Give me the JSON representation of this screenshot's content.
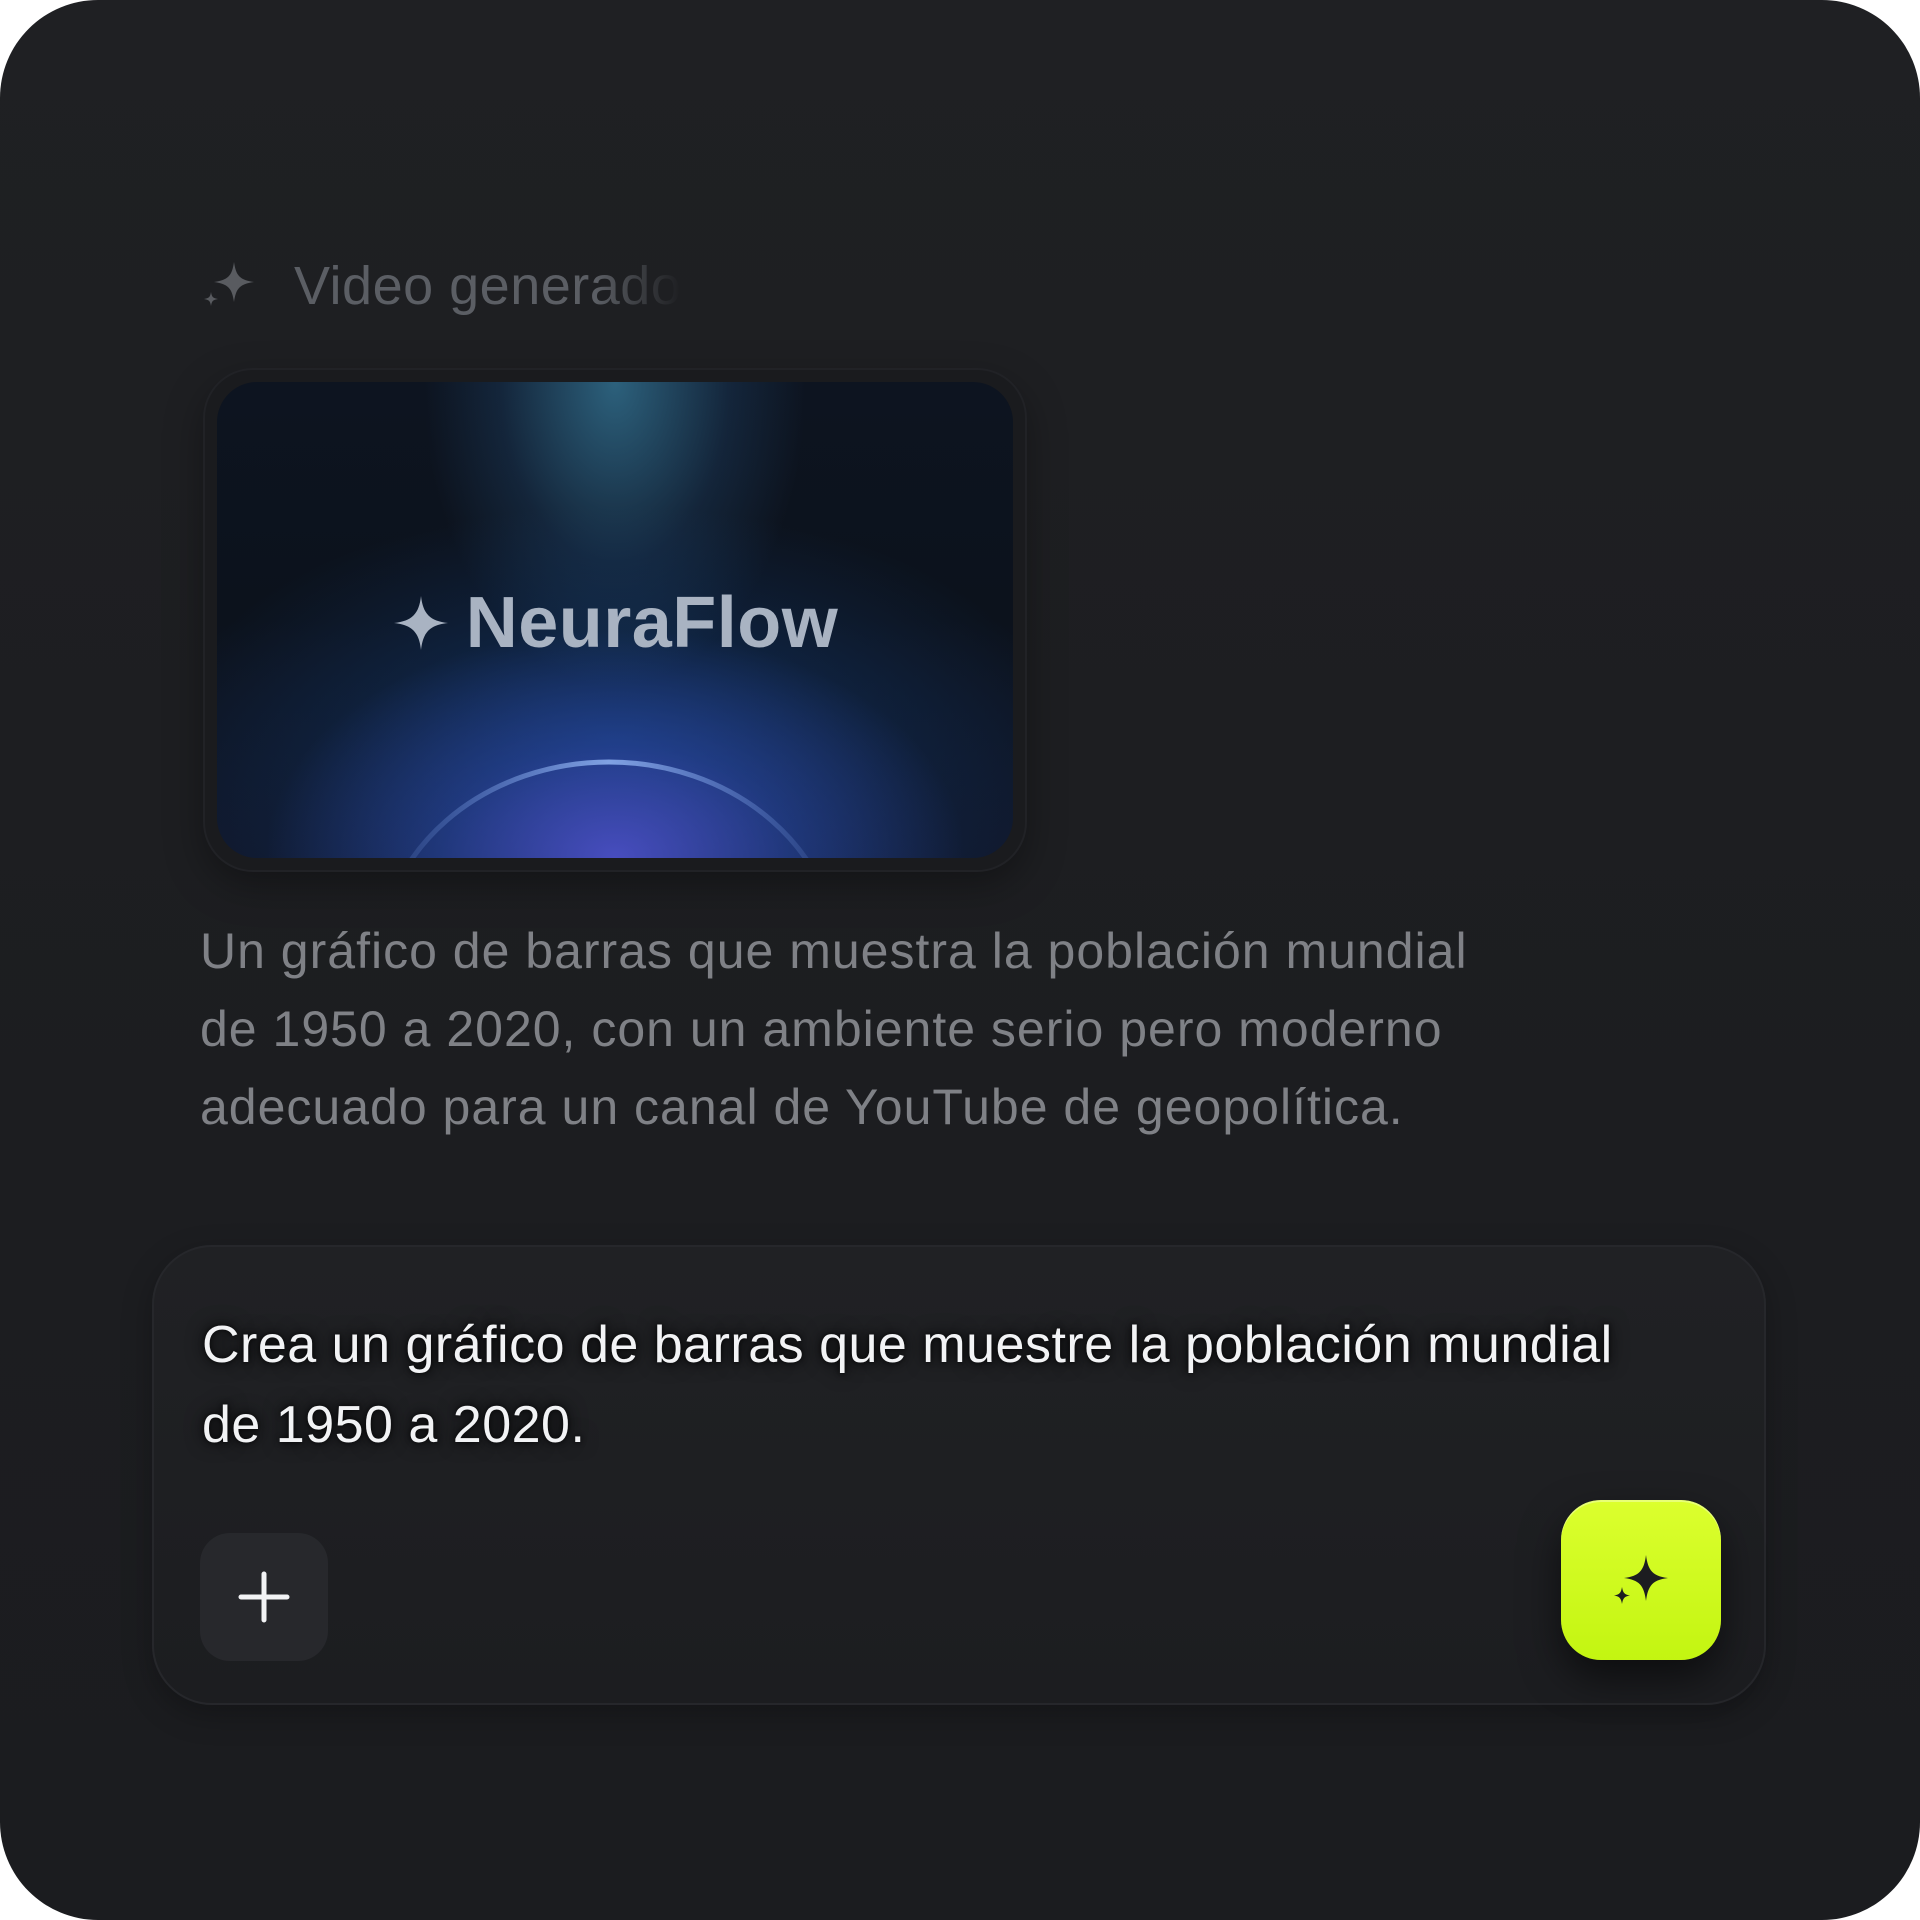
{
  "header": {
    "title": "Video generado",
    "icon": "sparkle-icon"
  },
  "video": {
    "brand_name": "NeuraFlow",
    "brand_icon": "sparkle-icon"
  },
  "description": {
    "lines": [
      "Un gráfico de barras que muestra la población mundial",
      "de 1950 a 2020, con un ambiente serio pero moderno",
      "adecuado para un canal de YouTube de geopolítica."
    ]
  },
  "composer": {
    "lines": [
      "Crea un gráfico de barras que muestre la población mundial",
      "de 1950 a 2020."
    ],
    "add_icon": "plus-icon",
    "generate_icon": "sparkle-icon",
    "accent_color": "#d4fb22"
  }
}
